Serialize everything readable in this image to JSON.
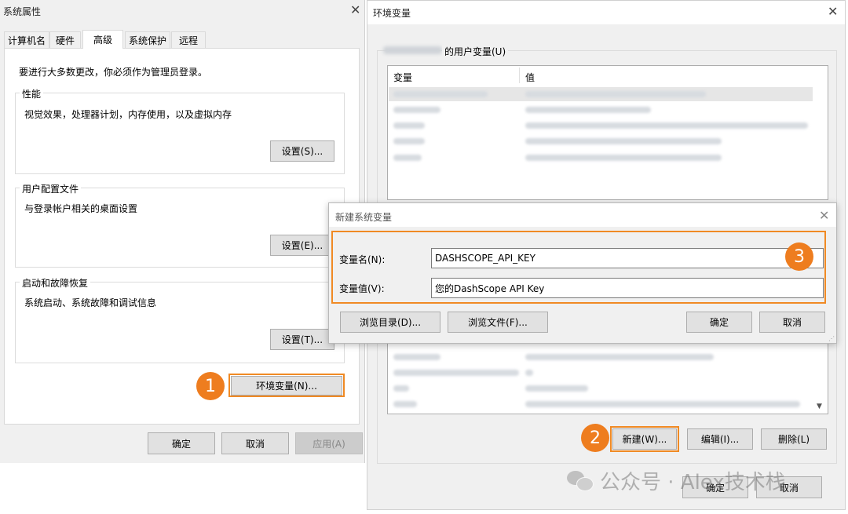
{
  "sysprops": {
    "title": "系统属性",
    "tabs": [
      "计算机名",
      "硬件",
      "高级",
      "系统保护",
      "远程"
    ],
    "admin_note": "要进行大多数更改，你必须作为管理员登录。",
    "performance": {
      "label": "性能",
      "desc": "视觉效果，处理器计划，内存使用，以及虚拟内存",
      "button": "设置(S)..."
    },
    "profiles": {
      "label": "用户配置文件",
      "desc": "与登录帐户相关的桌面设置",
      "button": "设置(E)..."
    },
    "startup": {
      "label": "启动和故障恢复",
      "desc": "系统启动、系统故障和调试信息",
      "button": "设置(T)..."
    },
    "env_button": "环境变量(N)...",
    "ok": "确定",
    "cancel": "取消",
    "apply": "应用(A)"
  },
  "envvars": {
    "title": "环境变量",
    "user_group": "的用户变量(U)",
    "col_var": "变量",
    "col_val": "值",
    "new_button": "新建(W)...",
    "edit_button": "编辑(I)...",
    "delete_button": "删除(L)",
    "ok": "确定",
    "cancel": "取消"
  },
  "newvar": {
    "title": "新建系统变量",
    "name_label": "变量名(N):",
    "value_label": "变量值(V):",
    "name_value": "DASHSCOPE_API_KEY",
    "value_value": "您的DashScope API Key",
    "browse_dir": "浏览目录(D)...",
    "browse_file": "浏览文件(F)...",
    "ok": "确定",
    "cancel": "取消"
  },
  "badges": [
    "1",
    "2",
    "3"
  ],
  "watermark": "公众号 · Alex技术栈",
  "colors": {
    "highlight": "#f08a24",
    "badge": "#ee7d1f"
  }
}
